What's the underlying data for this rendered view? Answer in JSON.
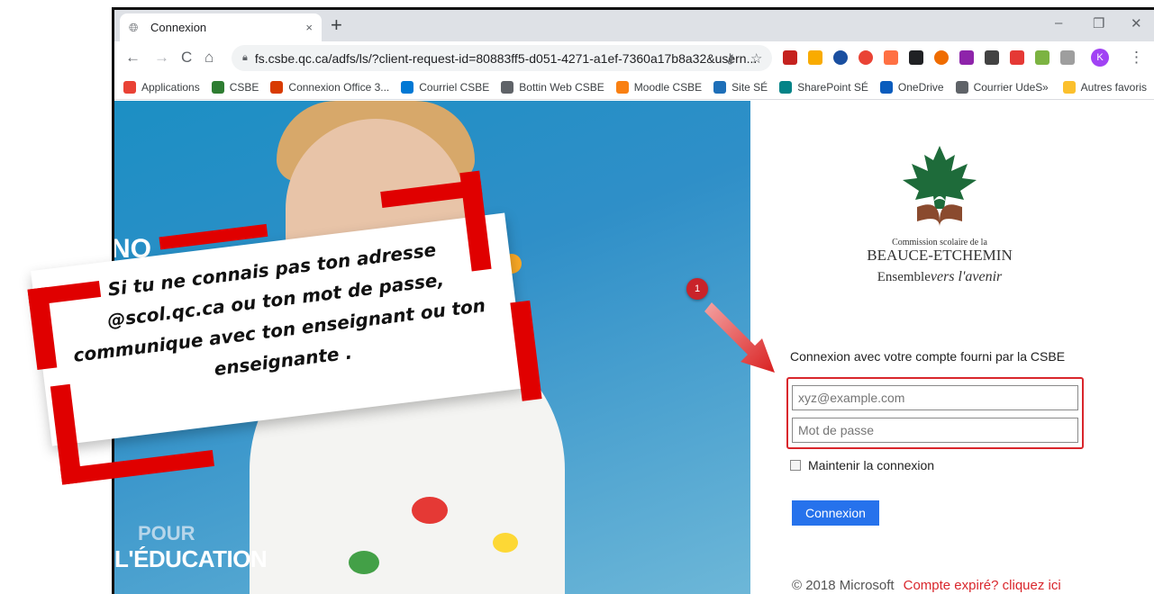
{
  "browser": {
    "tab_title": "Connexion",
    "tab_close": "×",
    "new_tab": "+",
    "window_controls": {
      "minimize": "–",
      "restore": "❐",
      "close": "✕"
    },
    "nav": {
      "back": "←",
      "forward": "→",
      "reload": "C",
      "home": "⌂"
    },
    "url": "fs.csbe.qc.ca/adfs/ls/?client-request-id=80883ff5-d051-4271-a1ef-7360a17b8a32&usern...",
    "profile_initial": "K",
    "menu": "⋮"
  },
  "bookmarks": {
    "items": [
      {
        "label": "Applications",
        "color": "#e94235"
      },
      {
        "label": "CSBE",
        "color": "#2e7d32"
      },
      {
        "label": "Connexion Office 3...",
        "color": "#d83b01"
      },
      {
        "label": "Courriel CSBE",
        "color": "#0078d4"
      },
      {
        "label": "Bottin Web CSBE",
        "color": "#5f6368"
      },
      {
        "label": "Moodle CSBE",
        "color": "#f98012"
      },
      {
        "label": "Site SÉ",
        "color": "#1e6fb8"
      },
      {
        "label": "SharePoint SÉ",
        "color": "#038387"
      },
      {
        "label": "OneDrive",
        "color": "#0a5cbd"
      },
      {
        "label": "Courrier UdeS",
        "color": "#5f6368"
      }
    ],
    "overflow": "»",
    "other": "Autres favoris"
  },
  "hero": {
    "vertical_text": "NO",
    "pour": "POUR",
    "education": "L'ÉDUCATION"
  },
  "login": {
    "logo_line1": "Commission scolaire de la",
    "logo_line2": "BEAUCE-ETCHEMIN",
    "logo_line3a": "Ensemble",
    "logo_line3b": "vers l'avenir",
    "heading": "Connexion avec votre compte fourni par la CSBE",
    "username_placeholder": "xyz@example.com",
    "password_placeholder": "Mot de passe",
    "remember_label": "Maintenir la connexion",
    "submit_label": "Connexion",
    "copyright": "© 2018 Microsoft",
    "expired_link": "Compte expiré? cliquez ici"
  },
  "annotation": {
    "marker_number": "1",
    "note_lines": [
      "Si tu ne connais pas ton adresse",
      "@scol.qc.ca ou ton mot de passe,",
      "communique avec ton enseignant ou ton",
      "enseignante ."
    ]
  },
  "colors": {
    "accent_red": "#d9262c",
    "button_blue": "#2672ec",
    "note_bar_red": "#e00000"
  }
}
